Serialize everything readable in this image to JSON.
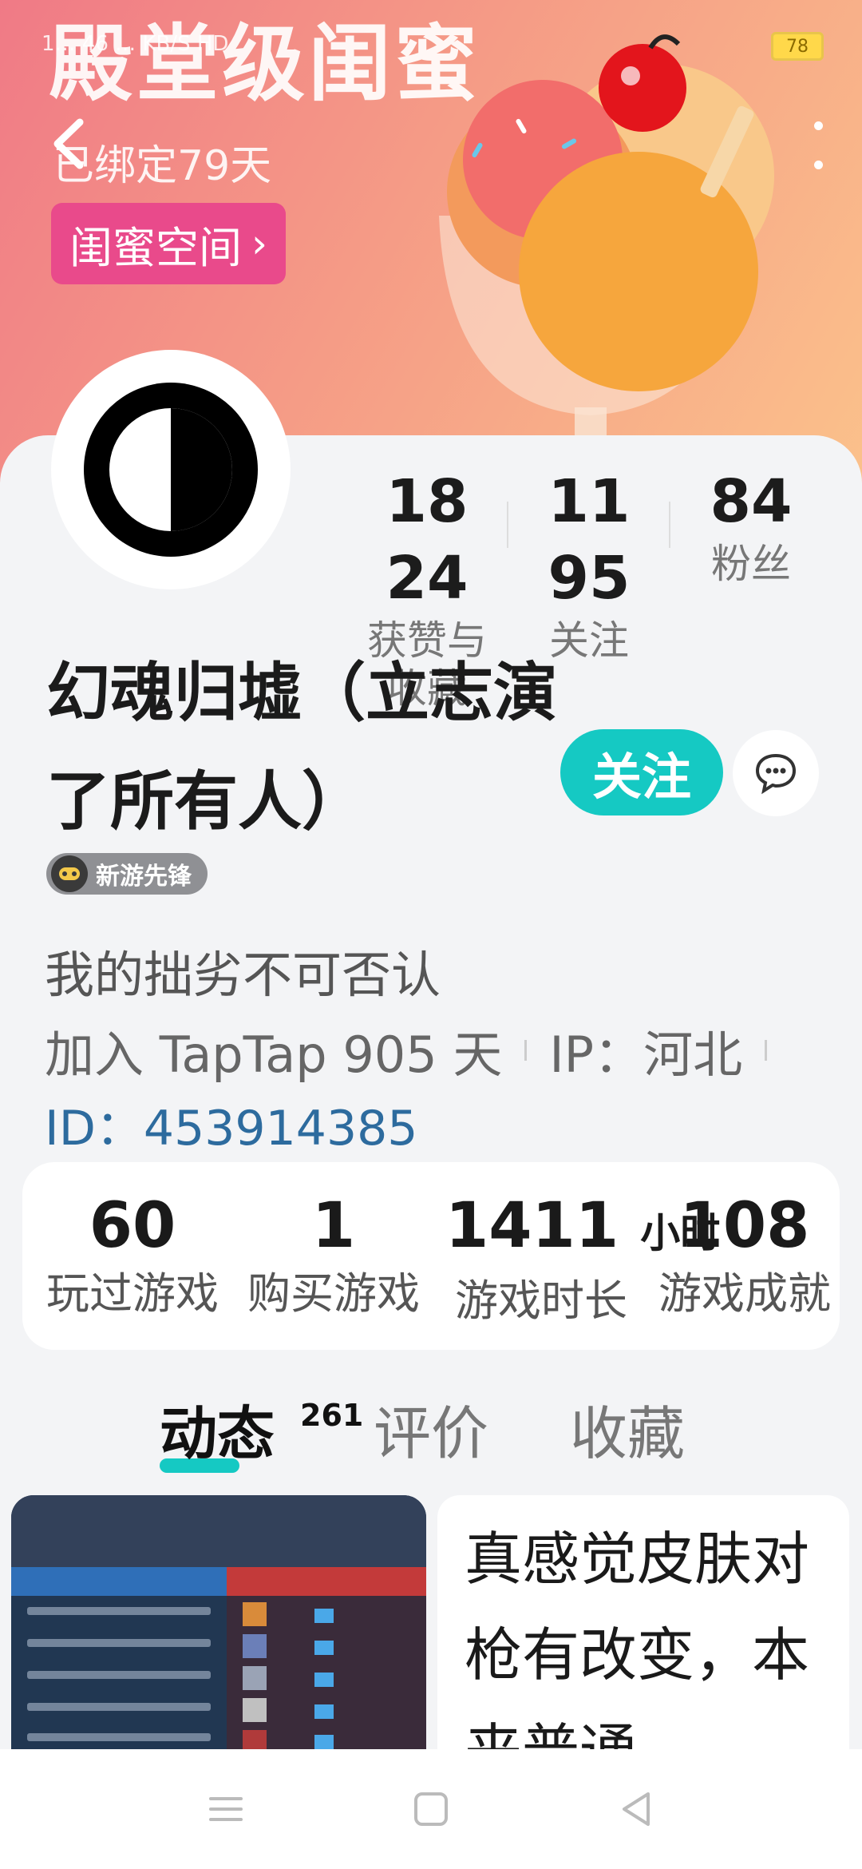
{
  "status_bar": {
    "left_text": "1…  46  …  KB/S  HD",
    "battery": "78"
  },
  "banner": {
    "title": "殿堂级闺蜜",
    "subtitle": "已绑定79天",
    "button_label": "闺蜜空间"
  },
  "profile": {
    "username": "幻魂归墟（立志演了所有人）",
    "badge": "新游先锋",
    "bio": "我的拙劣不可否认",
    "joined": "加入 TapTap 905 天",
    "ip": "IP：河北",
    "user_id": "ID：453914385",
    "follow_label": "关注"
  },
  "stats": [
    {
      "value": "1824",
      "label": "获赞与收藏"
    },
    {
      "value": "1195",
      "label": "关注"
    },
    {
      "value": "84",
      "label": "粉丝"
    }
  ],
  "game_stats": [
    {
      "value": "60",
      "unit": "",
      "label": "玩过游戏"
    },
    {
      "value": "1",
      "unit": "",
      "label": "购买游戏"
    },
    {
      "value": "1411",
      "unit": "小时",
      "label": "游戏时长"
    },
    {
      "value": "108",
      "unit": "",
      "label": "游戏成就"
    }
  ],
  "tabs": [
    {
      "label": "动态",
      "count": "261"
    },
    {
      "label": "评价"
    },
    {
      "label": "收藏"
    }
  ],
  "posts": [
    {
      "text": "真感觉皮肤对枪有改变，本来普通"
    }
  ],
  "colors": {
    "accent": "#15c9c3",
    "id_link": "#2d6b9e",
    "banner_button": "#e94a8b"
  }
}
